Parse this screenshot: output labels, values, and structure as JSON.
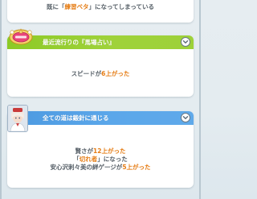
{
  "top_event": {
    "pre": "既に「",
    "highlight": "練習ベタ",
    "post": "」になってしまっている"
  },
  "event_fortune": {
    "title": "最近流行りの『馬場占い』",
    "effect": {
      "stat": "スピード",
      "connector": "が",
      "amount": "6上がった"
    }
  },
  "event_road": {
    "title": "全ての道は鍛針に通じる",
    "effects": [
      {
        "stat": "賢さ",
        "connector": "が",
        "amount": "12上がった"
      },
      {
        "prefix": "「",
        "skill": "切れ者",
        "suffix": "」になった"
      },
      {
        "text": "安心沢刺々美の絆ゲージが",
        "amount": "5上がった"
      }
    ]
  },
  "colors": {
    "green_header": "#9dd139",
    "blue_header": "#5ba7ea",
    "highlight_orange": "#e57c14",
    "body_text": "#555e66"
  },
  "icons": {
    "expand": "chevron-down-icon",
    "fortune_badge": "emblem-icon",
    "character": "avatar"
  }
}
